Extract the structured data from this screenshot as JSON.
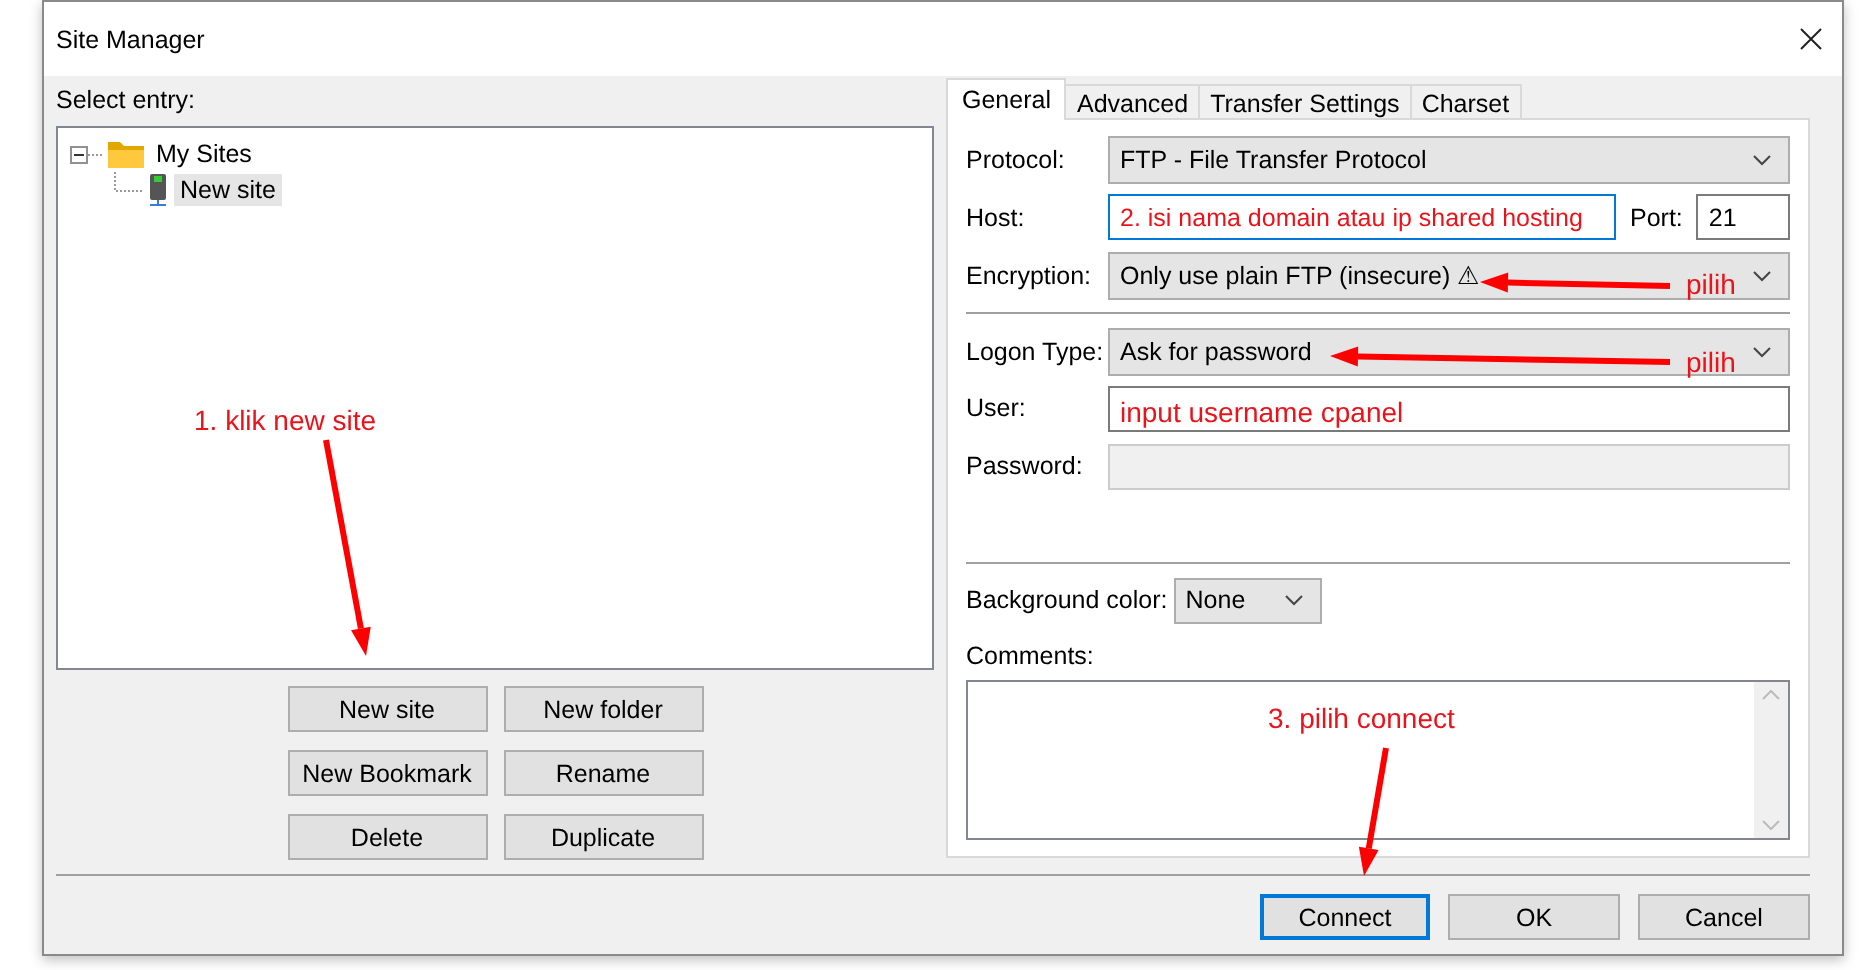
{
  "window": {
    "title": "Site Manager"
  },
  "select_entry_label": "Select entry:",
  "tree": [
    {
      "label": "My Sites",
      "kind": "folder",
      "expanded": true,
      "selected": false,
      "children": [
        {
          "label": "New site",
          "kind": "site",
          "selected": true
        }
      ]
    }
  ],
  "entry_buttons": [
    "New site",
    "New folder",
    "New Bookmark",
    "Rename",
    "Delete",
    "Duplicate"
  ],
  "tabs": [
    {
      "label": "General",
      "selected": true
    },
    {
      "label": "Advanced",
      "selected": false
    },
    {
      "label": "Transfer Settings",
      "selected": false
    },
    {
      "label": "Charset",
      "selected": false
    }
  ],
  "protocol": {
    "label": "Protocol:",
    "value": "FTP - File Transfer Protocol"
  },
  "host": {
    "label": "Host:",
    "focused": true
  },
  "port": {
    "label": "Port:",
    "value": "21"
  },
  "encryption": {
    "label": "Encryption:",
    "value": "Only use plain FTP (insecure) ⚠"
  },
  "logon_type": {
    "label": "Logon Type:",
    "value": "Ask for password"
  },
  "user": {
    "label": "User:"
  },
  "password": {
    "label": "Password:",
    "disabled": true
  },
  "background_color": {
    "label": "Background color:",
    "value": "None"
  },
  "comments": {
    "label": "Comments:"
  },
  "dialog_buttons": [
    {
      "label": "Connect",
      "default": true
    },
    {
      "label": "OK",
      "default": false
    },
    {
      "label": "Cancel",
      "default": false
    }
  ],
  "annotations": [
    {
      "kind": "text",
      "text": "1. klik new site"
    },
    {
      "kind": "arrow"
    },
    {
      "kind": "text",
      "text": "2. isi nama domain atau ip shared hosting"
    },
    {
      "kind": "text",
      "text": "pilih"
    },
    {
      "kind": "arrow"
    },
    {
      "kind": "text",
      "text": "pilih"
    },
    {
      "kind": "arrow"
    },
    {
      "kind": "text",
      "text": "input username cpanel"
    },
    {
      "kind": "text",
      "text": "3. pilih connect"
    },
    {
      "kind": "arrow"
    }
  ]
}
